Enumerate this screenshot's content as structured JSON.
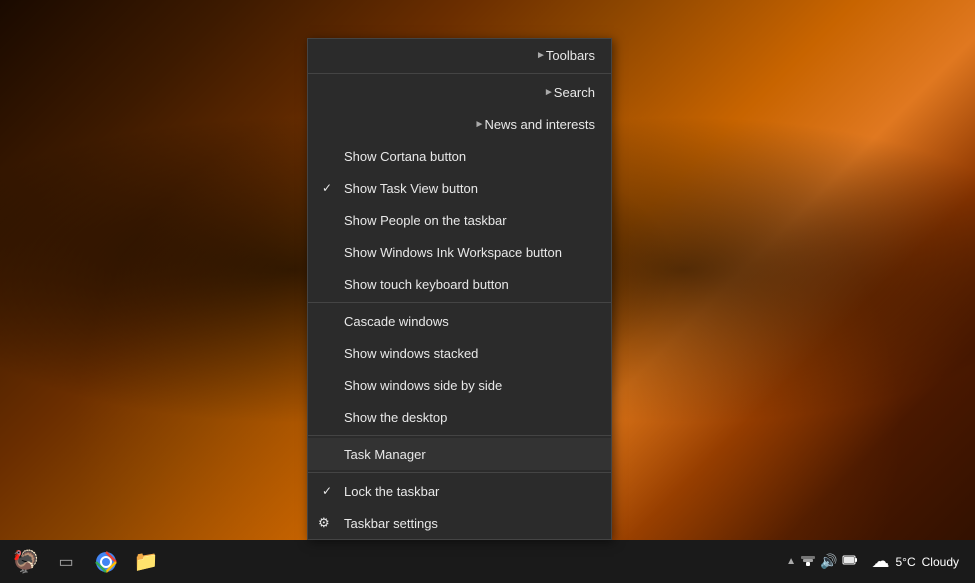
{
  "desktop": {
    "background_description": "Forest autumn scene with orange and red leaves"
  },
  "contextMenu": {
    "items": [
      {
        "id": "toolbars",
        "label": "Toolbars",
        "hasArrow": true,
        "hasCheck": false,
        "hasSeparatorAfter": false,
        "isGroupStart": true,
        "icon": null
      },
      {
        "id": "search",
        "label": "Search",
        "hasArrow": true,
        "hasCheck": false,
        "hasSeparatorAfter": false,
        "isGroupStart": false,
        "icon": null
      },
      {
        "id": "news-and-interests",
        "label": "News and interests",
        "hasArrow": true,
        "hasCheck": false,
        "hasSeparatorAfter": false,
        "isGroupStart": false,
        "icon": null
      },
      {
        "id": "show-cortana-button",
        "label": "Show Cortana button",
        "hasArrow": false,
        "hasCheck": false,
        "hasSeparatorAfter": false,
        "isGroupStart": false,
        "icon": null
      },
      {
        "id": "show-task-view-button",
        "label": "Show Task View button",
        "hasArrow": false,
        "hasCheck": true,
        "hasSeparatorAfter": false,
        "isGroupStart": false,
        "icon": null
      },
      {
        "id": "show-people-on-taskbar",
        "label": "Show People on the taskbar",
        "hasArrow": false,
        "hasCheck": false,
        "hasSeparatorAfter": false,
        "isGroupStart": false,
        "icon": null
      },
      {
        "id": "show-windows-ink",
        "label": "Show Windows Ink Workspace button",
        "hasArrow": false,
        "hasCheck": false,
        "hasSeparatorAfter": false,
        "isGroupStart": false,
        "icon": null
      },
      {
        "id": "show-touch-keyboard",
        "label": "Show touch keyboard button",
        "hasArrow": false,
        "hasCheck": false,
        "hasSeparatorAfter": true,
        "isGroupStart": false,
        "icon": null
      },
      {
        "id": "cascade-windows",
        "label": "Cascade windows",
        "hasArrow": false,
        "hasCheck": false,
        "hasSeparatorAfter": false,
        "isGroupStart": false,
        "icon": null
      },
      {
        "id": "show-windows-stacked",
        "label": "Show windows stacked",
        "hasArrow": false,
        "hasCheck": false,
        "hasSeparatorAfter": false,
        "isGroupStart": false,
        "icon": null
      },
      {
        "id": "show-windows-side-by-side",
        "label": "Show windows side by side",
        "hasArrow": false,
        "hasCheck": false,
        "hasSeparatorAfter": false,
        "isGroupStart": false,
        "icon": null
      },
      {
        "id": "show-the-desktop",
        "label": "Show the desktop",
        "hasArrow": false,
        "hasCheck": false,
        "hasSeparatorAfter": true,
        "isGroupStart": false,
        "icon": null
      },
      {
        "id": "task-manager",
        "label": "Task Manager",
        "hasArrow": false,
        "hasCheck": false,
        "hasSeparatorAfter": true,
        "isGroupStart": false,
        "highlighted": true,
        "icon": null
      },
      {
        "id": "lock-the-taskbar",
        "label": "Lock the taskbar",
        "hasArrow": false,
        "hasCheck": true,
        "hasSeparatorAfter": false,
        "isGroupStart": false,
        "icon": null
      },
      {
        "id": "taskbar-settings",
        "label": "Taskbar settings",
        "hasArrow": false,
        "hasCheck": false,
        "hasSeparatorAfter": false,
        "isGroupStart": false,
        "icon": "gear"
      }
    ]
  },
  "taskbar": {
    "icons": [
      {
        "id": "start",
        "symbol": "🦃",
        "label": "Start"
      },
      {
        "id": "task-view",
        "symbol": "⊞",
        "label": "Task View"
      },
      {
        "id": "chrome",
        "symbol": "🌐",
        "label": "Google Chrome"
      },
      {
        "id": "explorer",
        "symbol": "📁",
        "label": "File Explorer"
      }
    ],
    "tray": {
      "chevron": "^",
      "network": "📶",
      "volume": "🔊",
      "battery": "🔋",
      "weather_icon": "☁",
      "weather_temp": "5°C",
      "weather_desc": "Cloudy"
    }
  }
}
